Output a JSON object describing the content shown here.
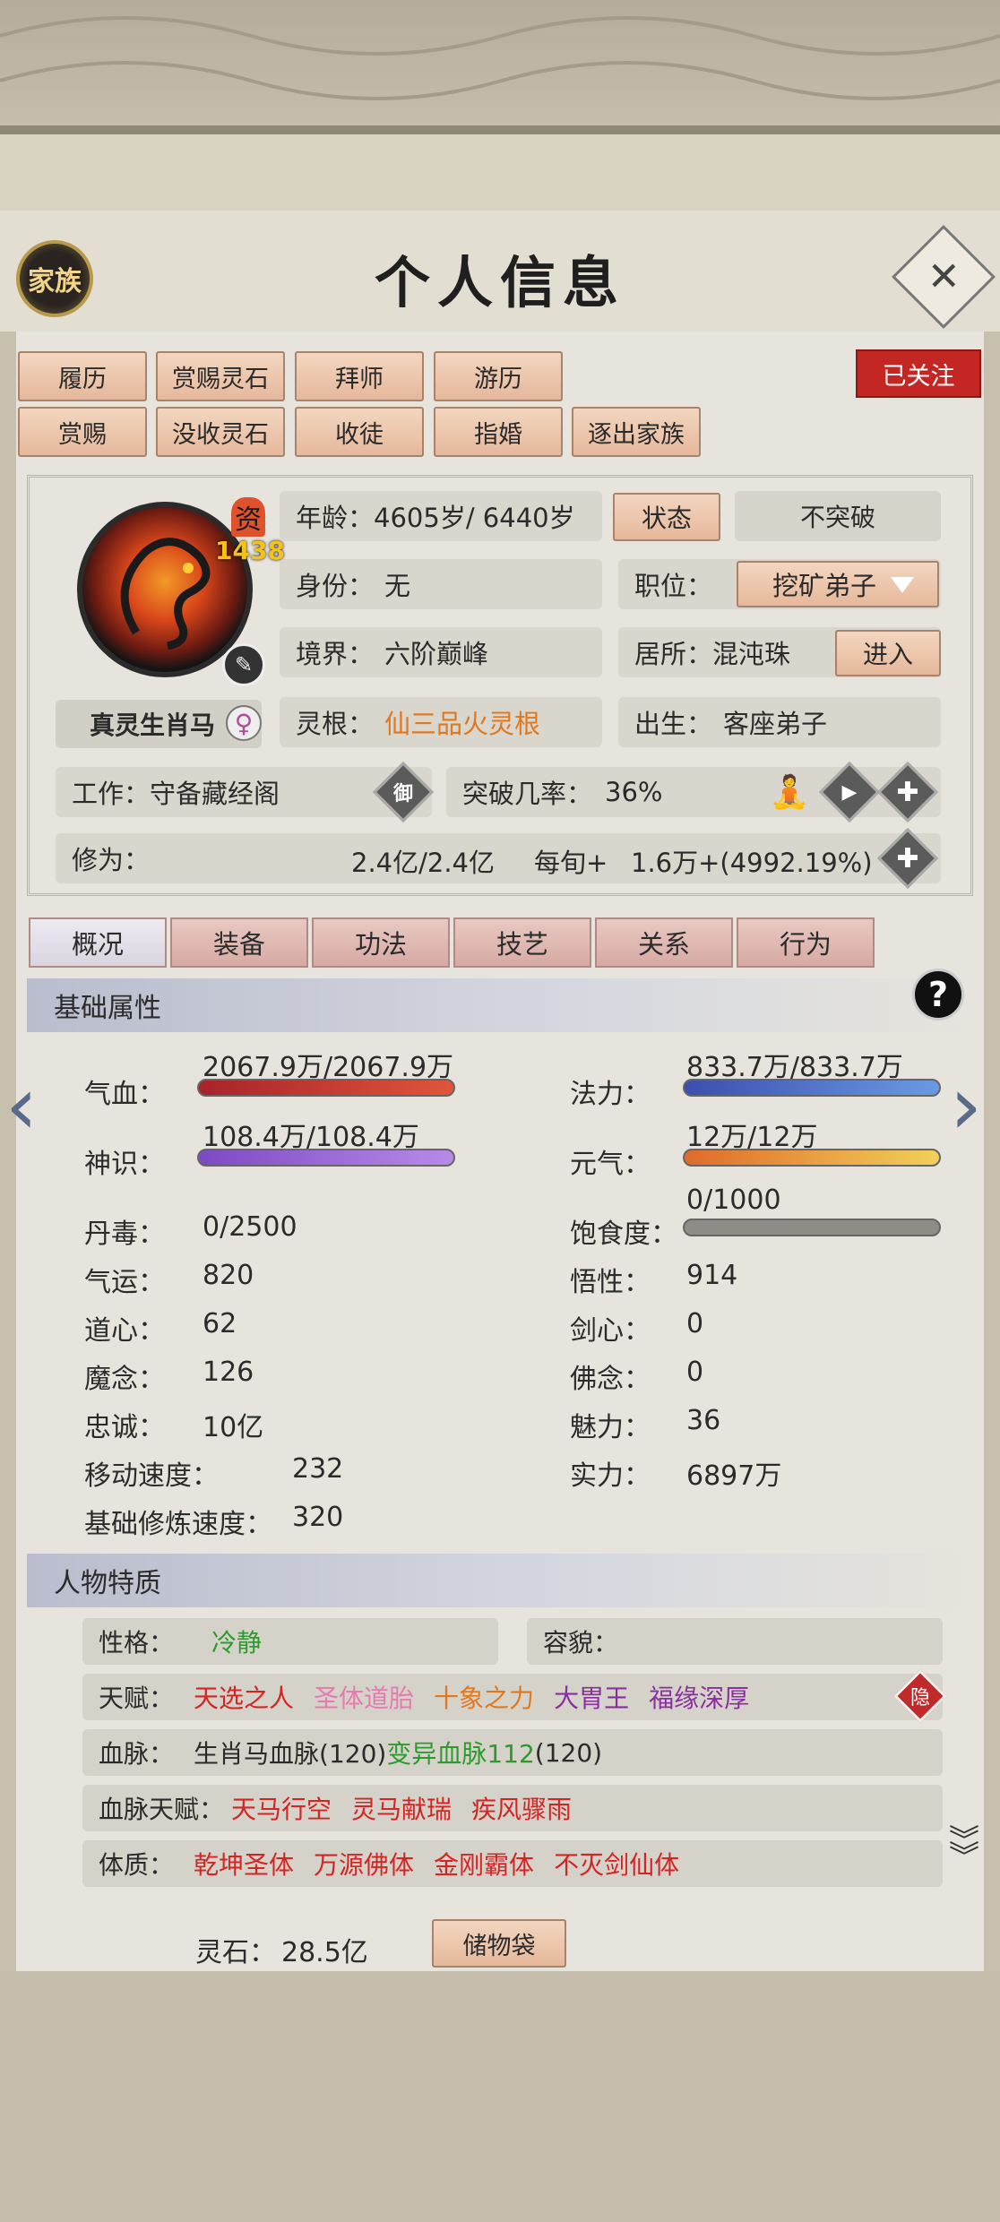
{
  "header": {
    "title": "个人信息",
    "clan_label": "家族",
    "close_label": "✕"
  },
  "actions": {
    "row1": [
      "履历",
      "赏赐灵石",
      "拜师",
      "游历"
    ],
    "row2": [
      "赏赐",
      "没收灵石",
      "收徒",
      "指婚",
      "逐出家族"
    ],
    "followed": "已关注"
  },
  "profile": {
    "zi_label": "资",
    "zi_value": "1438",
    "name": "真灵生肖马",
    "gender_icon": "♀",
    "age_label": "年龄：",
    "age_value": "4605岁/ 6440岁",
    "status_btn": "状态",
    "breakthrough_btn": "不突破",
    "identity_label": "身份：",
    "identity_value": "无",
    "position_label": "职位：",
    "position_value": "挖矿弟子",
    "realm_label": "境界：",
    "realm_value": "六阶巅峰",
    "residence_label": "居所：",
    "residence_value": "混沌珠",
    "enter_btn": "进入",
    "root_label": "灵根：",
    "root_value": "仙三品火灵根",
    "birth_label": "出生：",
    "birth_value": "客座弟子",
    "work_label": "工作：",
    "work_value": "守备藏经阁",
    "work_icon": "御",
    "chance_label": "突破几率：",
    "chance_value": "36%",
    "cult_label": "修为：",
    "cult_value": "2.4亿/2.4亿",
    "cult_rate_label": "每旬+",
    "cult_rate_value": "1.6万+(4992.19%)"
  },
  "tabs": [
    "概况",
    "装备",
    "功法",
    "技艺",
    "关系",
    "行为"
  ],
  "basic": {
    "heading": "基础属性",
    "help": "?",
    "hp_label": "气血：",
    "hp_value": "2067.9万/2067.9万",
    "hp_fill": 1.0,
    "mp_label": "法力：",
    "mp_value": "833.7万/833.7万",
    "mp_fill": 1.0,
    "sense_label": "神识：",
    "sense_value": "108.4万/108.4万",
    "sense_fill": 1.0,
    "vital_label": "元气：",
    "vital_value": "12万/12万",
    "vital_fill": 1.0,
    "satiety_label": "饱食度：",
    "satiety_value": "0/1000",
    "satiety_fill": 0,
    "stats_left": [
      {
        "label": "丹毒：",
        "value": "0/2500"
      },
      {
        "label": "气运：",
        "value": "820"
      },
      {
        "label": "道心：",
        "value": "62"
      },
      {
        "label": "魔念：",
        "value": "126"
      },
      {
        "label": "忠诚：",
        "value": "10亿"
      }
    ],
    "stats_right": [
      {
        "label": "悟性：",
        "value": "914"
      },
      {
        "label": "剑心：",
        "value": "0"
      },
      {
        "label": "佛念：",
        "value": "0"
      },
      {
        "label": "魅力：",
        "value": "36"
      },
      {
        "label": "实力：",
        "value": "6897万"
      }
    ],
    "speed_label": "移动速度：",
    "speed_value": "232",
    "train_label": "基础修炼速度：",
    "train_value": "320"
  },
  "traits": {
    "heading": "人物特质",
    "personality_label": "性格：",
    "personality_value": "冷静",
    "looks_label": "容貌：",
    "talent_label": "天赋：",
    "talents": [
      "天选之人",
      "圣体道胎",
      "十象之力",
      "大胃王",
      "福缘深厚"
    ],
    "hide_label": "隐",
    "blood_label": "血脉：",
    "blood_a": "生肖马血脉(120)",
    "blood_b": "变异血脉112",
    "blood_c": "(120)",
    "bloodtalent_label": "血脉天赋：",
    "bloodtalents": [
      "天马行空",
      "灵马献瑞",
      "疾风骤雨"
    ],
    "body_label": "体质：",
    "bodies": [
      "乾坤圣体",
      "万源佛体",
      "金刚霸体",
      "不灭剑仙体"
    ]
  },
  "footer": {
    "stone_label": "灵石：",
    "stone_value": "28.5亿",
    "storage_btn": "储物袋"
  },
  "colors": {
    "accent_red": "#c42624",
    "hp": "#c0392b",
    "mp": "#4a6fd1",
    "sense": "#9b6bd6",
    "vital": "#e0b040",
    "root": "#e07820"
  }
}
